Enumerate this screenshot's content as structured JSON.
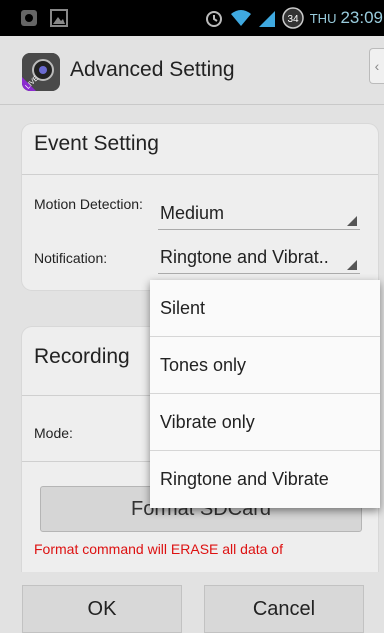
{
  "status_bar": {
    "day": "THU",
    "time": "23:09",
    "notification_badge": "34"
  },
  "header": {
    "title": "Advanced Setting",
    "app_icon_text": "LIVE"
  },
  "event_setting": {
    "title": "Event Setting",
    "motion_label": "Motion Detection:",
    "motion_value": "Medium",
    "notification_label": "Notification:",
    "notification_value": "Ringtone and Vibrat.."
  },
  "recording": {
    "title": "Recording",
    "mode_label": "Mode:",
    "format_button": "Format SDCard",
    "warning": "Format command will ERASE all data of"
  },
  "notification_options": [
    "Silent",
    "Tones only",
    "Vibrate only",
    "Ringtone and Vibrate"
  ],
  "buttons": {
    "ok": "OK",
    "cancel": "Cancel"
  }
}
